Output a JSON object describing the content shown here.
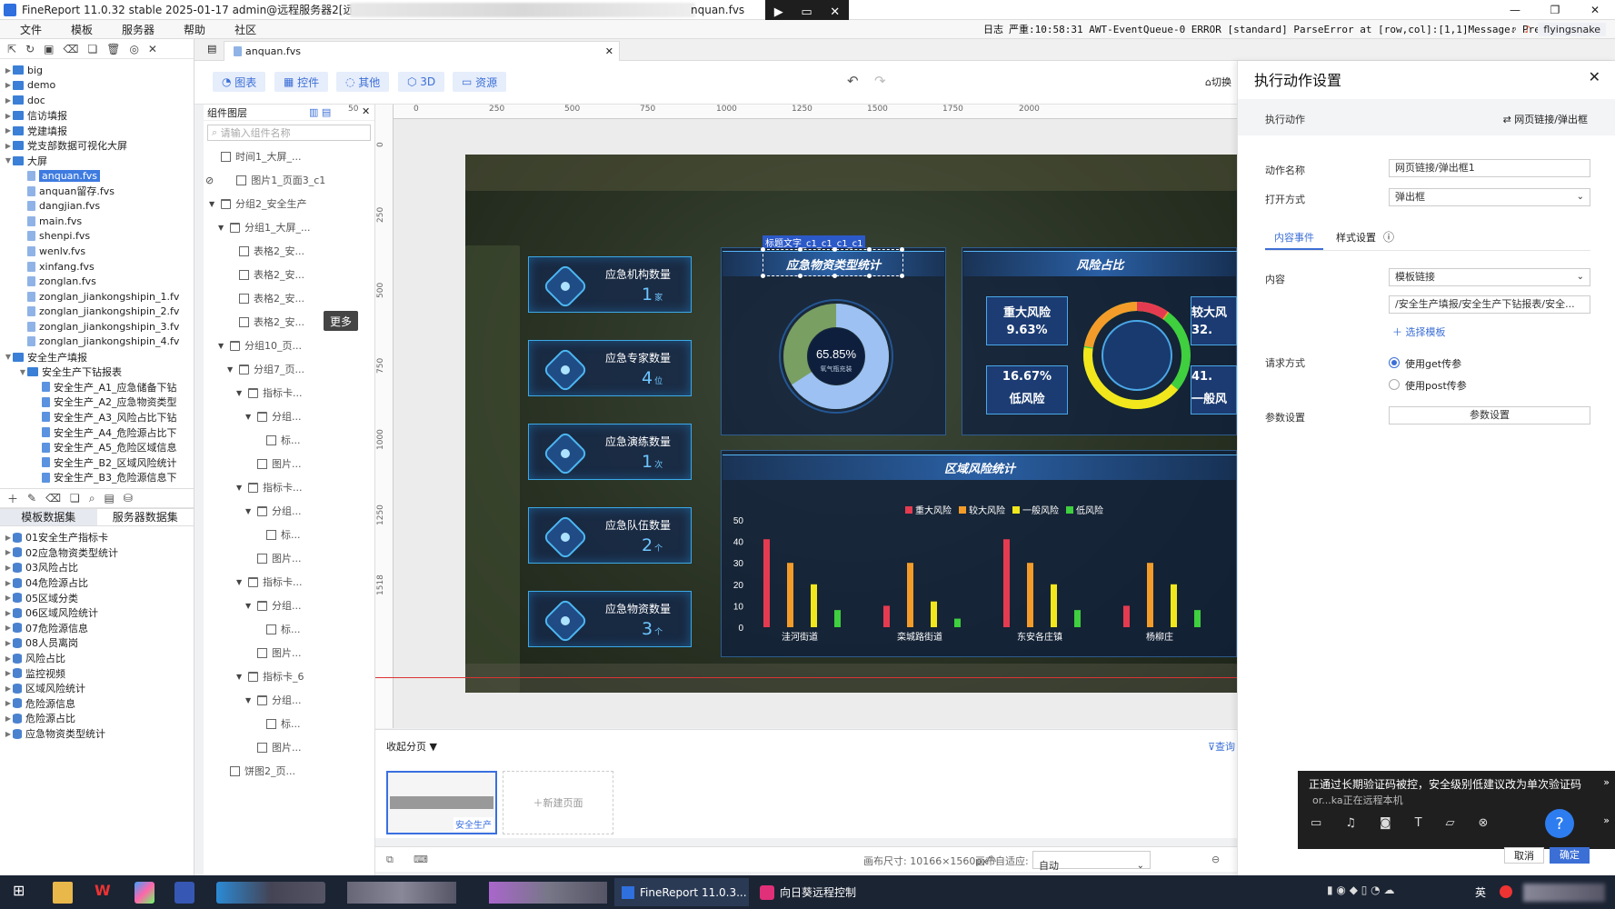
{
  "titlebar": {
    "title": "FineReport 11.0.32 stable 2025-01-17 admin@远程服务器2[远程环",
    "file_suffix": "nquan.fvs",
    "remote_icons": [
      "▶",
      "▭",
      "✕"
    ],
    "controls": [
      "—",
      "❐",
      "✕"
    ]
  },
  "menubar": {
    "items": [
      "文件",
      "模板",
      "服务器",
      "帮助",
      "社区"
    ],
    "log_label": "日志",
    "log_text": "严重:10:58:31 AWT-EventQueue-0 ERROR [standard] ParseError at [row,col]:[1,1]Message: Prem...",
    "user": "flyingsnake"
  },
  "left_tree": {
    "items": [
      {
        "label": "big",
        "type": "folder",
        "level": 0,
        "arrow": "▶"
      },
      {
        "label": "demo",
        "type": "folder",
        "level": 0,
        "arrow": "▶"
      },
      {
        "label": "doc",
        "type": "folder",
        "level": 0,
        "arrow": "▶"
      },
      {
        "label": "信访填报",
        "type": "folder",
        "level": 0,
        "arrow": "▶"
      },
      {
        "label": "党建填报",
        "type": "folder",
        "level": 0,
        "arrow": "▶"
      },
      {
        "label": "党支部数据可视化大屏",
        "type": "folder",
        "level": 0,
        "arrow": "▶"
      },
      {
        "label": "大屏",
        "type": "folder",
        "level": 0,
        "arrow": "▼"
      },
      {
        "label": "anquan.fvs",
        "type": "file",
        "level": 1,
        "selected": true
      },
      {
        "label": "anquan留存.fvs",
        "type": "file",
        "level": 1
      },
      {
        "label": "dangjian.fvs",
        "type": "file",
        "level": 1
      },
      {
        "label": "main.fvs",
        "type": "file",
        "level": 1
      },
      {
        "label": "shenpi.fvs",
        "type": "file",
        "level": 1
      },
      {
        "label": "wenlv.fvs",
        "type": "file",
        "level": 1
      },
      {
        "label": "xinfang.fvs",
        "type": "file",
        "level": 1
      },
      {
        "label": "zonglan.fvs",
        "type": "file",
        "level": 1
      },
      {
        "label": "zonglan_jiankongshipin_1.fv",
        "type": "file",
        "level": 1
      },
      {
        "label": "zonglan_jiankongshipin_2.fv",
        "type": "file",
        "level": 1
      },
      {
        "label": "zonglan_jiankongshipin_3.fv",
        "type": "file",
        "level": 1
      },
      {
        "label": "zonglan_jiankongshipin_4.fv",
        "type": "file",
        "level": 1
      },
      {
        "label": "安全生产填报",
        "type": "folder",
        "level": 0,
        "arrow": "▼"
      },
      {
        "label": "安全生产下钻报表",
        "type": "folder",
        "level": 1,
        "arrow": "▼"
      },
      {
        "label": "安全生产_A1_应急储备下钻",
        "type": "doc",
        "level": 2
      },
      {
        "label": "安全生产_A2_应急物资类型",
        "type": "doc",
        "level": 2
      },
      {
        "label": "安全生产_A3_风险占比下钻",
        "type": "doc",
        "level": 2
      },
      {
        "label": "安全生产_A4_危险源占比下",
        "type": "doc",
        "level": 2
      },
      {
        "label": "安全生产_A5_危险区域信息",
        "type": "doc",
        "level": 2
      },
      {
        "label": "安全生产_B2_区域风险统计",
        "type": "doc",
        "level": 2
      },
      {
        "label": "安全生产_B3_危险源信息下",
        "type": "doc",
        "level": 2
      }
    ]
  },
  "dataset_tabs": {
    "template": "模板数据集",
    "server": "服务器数据集"
  },
  "datasets": [
    "01安全生产指标卡",
    "02应急物资类型统计",
    "03风险占比",
    "04危险源占比",
    "05区域分类",
    "06区域风险统计",
    "07危险源信息",
    "08人员离岗",
    "风险占比",
    "监控视频",
    "区域风险统计",
    "危险源信息",
    "危险源占比",
    "应急物资类型统计"
  ],
  "file_tab": {
    "name": "anquan.fvs",
    "close": "✕"
  },
  "comp_toolbar": {
    "buttons": [
      "图表",
      "控件",
      "其他",
      "3D",
      "资源"
    ],
    "switch_label": "切换"
  },
  "layer_panel": {
    "title": "组件图层",
    "search_placeholder": "请输入组件名称",
    "more_badge": "更多",
    "rows": [
      {
        "label": "时间1_大屏_...",
        "indent": 0,
        "tri": ""
      },
      {
        "label": "图片1_页面3_c1",
        "indent": 0,
        "tri": "",
        "eye": true
      },
      {
        "label": "分组2_安全生产",
        "indent": 0,
        "tri": "▼",
        "folder": true
      },
      {
        "label": "分组1_大屏_...",
        "indent": 1,
        "tri": "▼",
        "folder": true
      },
      {
        "label": "表格2_安...",
        "indent": 2,
        "tri": ""
      },
      {
        "label": "表格2_安...",
        "indent": 2,
        "tri": ""
      },
      {
        "label": "表格2_安...",
        "indent": 2,
        "tri": ""
      },
      {
        "label": "表格2_安...",
        "indent": 2,
        "tri": ""
      },
      {
        "label": "分组10_页...",
        "indent": 1,
        "tri": "▼",
        "folder": true
      },
      {
        "label": "分组7_页...",
        "indent": 2,
        "tri": "▼",
        "folder": true
      },
      {
        "label": "指标卡...",
        "indent": 3,
        "tri": "▼",
        "folder": true
      },
      {
        "label": "分组...",
        "indent": 4,
        "tri": "▼",
        "folder": true
      },
      {
        "label": "标...",
        "indent": 5,
        "tri": ""
      },
      {
        "label": "图片...",
        "indent": 4,
        "tri": ""
      },
      {
        "label": "指标卡...",
        "indent": 3,
        "tri": "▼",
        "folder": true
      },
      {
        "label": "分组...",
        "indent": 4,
        "tri": "▼",
        "folder": true
      },
      {
        "label": "标...",
        "indent": 5,
        "tri": ""
      },
      {
        "label": "图片...",
        "indent": 4,
        "tri": ""
      },
      {
        "label": "指标卡...",
        "indent": 3,
        "tri": "▼",
        "folder": true
      },
      {
        "label": "分组...",
        "indent": 4,
        "tri": "▼",
        "folder": true
      },
      {
        "label": "标...",
        "indent": 5,
        "tri": ""
      },
      {
        "label": "图片...",
        "indent": 4,
        "tri": ""
      },
      {
        "label": "指标卡_6",
        "indent": 3,
        "tri": "▼",
        "folder": true
      },
      {
        "label": "分组...",
        "indent": 4,
        "tri": "▼",
        "folder": true
      },
      {
        "label": "标...",
        "indent": 5,
        "tri": ""
      },
      {
        "label": "图片...",
        "indent": 4,
        "tri": ""
      },
      {
        "label": "饼图2_页...",
        "indent": 1,
        "tri": ""
      }
    ]
  },
  "ruler": {
    "top": [
      "50",
      "0",
      "250",
      "500",
      "750",
      "1000",
      "1250",
      "1500",
      "1750",
      "2000"
    ],
    "left": [
      "0",
      "250",
      "500",
      "750",
      "1000",
      "1250",
      "1518"
    ]
  },
  "dashboard": {
    "cards": [
      {
        "label": "应急机构数量",
        "value": "1",
        "unit": "家"
      },
      {
        "label": "应急专家数量",
        "value": "4",
        "unit": "位"
      },
      {
        "label": "应急演练数量",
        "value": "1",
        "unit": "次"
      },
      {
        "label": "应急队伍数量",
        "value": "2",
        "unit": "个"
      },
      {
        "label": "应急物资数量",
        "value": "3",
        "unit": "个"
      }
    ],
    "selected_label": "标题文字_c1_c1_c1_c1",
    "panel1_title": "应急物资类型统计",
    "donut_pct": "65.85%",
    "donut_sub": "氧气瓶充装",
    "donut_value": 65.85,
    "panel2_title": "风险占比",
    "risk_boxes": [
      {
        "name": "重大风险",
        "pct": "9.63%"
      },
      {
        "name": "低风险",
        "pct": "16.67%"
      },
      {
        "name": "较大风",
        "pct": "32."
      },
      {
        "name": "一般风",
        "pct": "41."
      }
    ],
    "panel3_title": "区域风险统计",
    "legend": [
      {
        "name": "重大风险",
        "color": "#e53b50"
      },
      {
        "name": "较大风险",
        "color": "#f39c2a"
      },
      {
        "name": "一般风险",
        "color": "#f2e71c"
      },
      {
        "name": "低风险",
        "color": "#3fcf3f"
      }
    ],
    "y_ticks": [
      "50",
      "40",
      "30",
      "20",
      "10",
      "0"
    ],
    "chart_data": {
      "type": "bar",
      "categories": [
        "洼河街道",
        "栾城路街道",
        "东安各庄镇",
        "杨柳庄"
      ],
      "series": [
        {
          "name": "重大风险",
          "values": [
            41,
            10,
            41,
            10
          ]
        },
        {
          "name": "较大风险",
          "values": [
            30,
            30,
            30,
            30
          ]
        },
        {
          "name": "一般风险",
          "values": [
            20,
            12,
            20,
            20
          ]
        },
        {
          "name": "低风险",
          "values": [
            8,
            4,
            8,
            8
          ]
        }
      ],
      "ylim": [
        0,
        50
      ]
    }
  },
  "page_strip": {
    "collapse_label": "收起分页",
    "query_label": "查询",
    "page_label": "安全生产",
    "new_page": "＋新建页面"
  },
  "status_bar": {
    "canvas_size": "画布尺寸: 10166×1560px",
    "auto_fit_label": "画布自适应:",
    "auto_fit_value": "自动"
  },
  "dialog": {
    "title": "执行动作设置",
    "action_label": "执行动作",
    "action_value": "网页链接/弹出框",
    "name_label": "动作名称",
    "name_value": "网页链接/弹出框1",
    "open_label": "打开方式",
    "open_value": "弹出框",
    "tab_content": "内容事件",
    "tab_style": "样式设置",
    "content_label": "内容",
    "content_type": "模板链接",
    "content_path": "/安全生产填报/安全生产下钻报表/安全...",
    "choose_template": "选择模板",
    "request_label": "请求方式",
    "req_get": "使用get传参",
    "req_post": "使用post传参",
    "param_label": "参数设置",
    "param_button": "参数设置",
    "cancel": "取消",
    "ok": "确定"
  },
  "notification": {
    "message": "正通过长期验证码被控，安全级别低建议改为单次验证码",
    "sub": "or...ka正在远程本机",
    "help": "?"
  },
  "taskbar": {
    "fr_label": "FineReport 11.0.3...",
    "remote_label": "向日葵远程控制",
    "ime": "英"
  }
}
